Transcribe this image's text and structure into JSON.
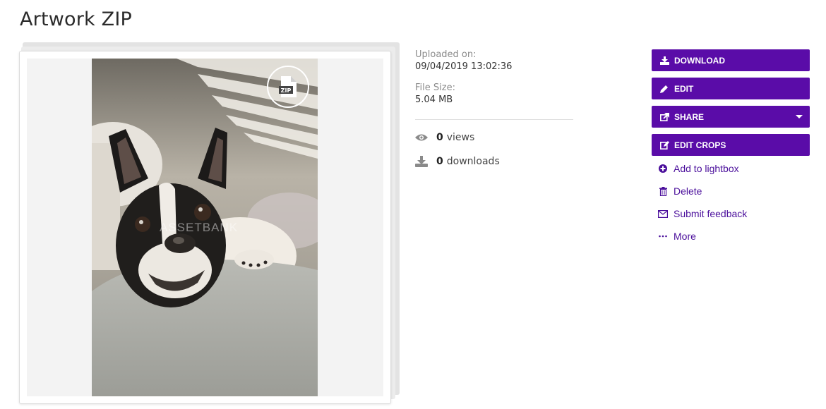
{
  "page": {
    "title": "Artwork ZIP"
  },
  "preview": {
    "badge_icon": "zip-file-icon",
    "badge_text": "ZIP",
    "watermark": "ASSETBANK"
  },
  "meta": {
    "uploaded_label": "Uploaded on:",
    "uploaded_value": "09/04/2019 13:02:36",
    "size_label": "File Size:",
    "size_value": "5.04 MB"
  },
  "stats": {
    "views_count": "0",
    "views_label": "views",
    "downloads_count": "0",
    "downloads_label": "downloads"
  },
  "actions": {
    "download": "DOWNLOAD",
    "edit": "EDIT",
    "share": "SHARE",
    "edit_crops": "EDIT CROPS"
  },
  "links": {
    "lightbox": "Add to lightbox",
    "delete": "Delete",
    "feedback": "Submit feedback",
    "more": "More"
  },
  "colors": {
    "accent": "#5a0ca8",
    "link": "#4a0e9b"
  }
}
